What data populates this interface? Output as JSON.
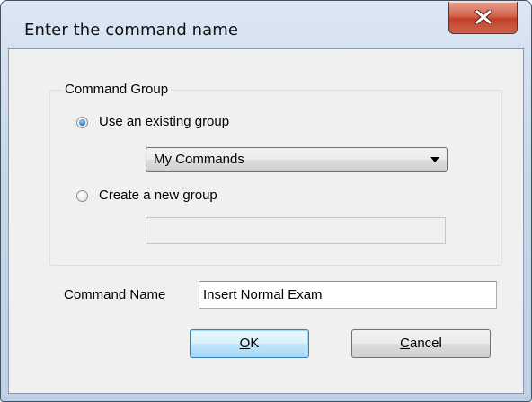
{
  "window": {
    "title": "Enter the command name",
    "close_icon": "close-icon"
  },
  "group": {
    "legend": "Command Group",
    "options": [
      {
        "label": "Use an existing group",
        "checked": true
      },
      {
        "label": "Create a new group",
        "checked": false
      }
    ],
    "existing_group_selected": "My Commands",
    "new_group_value": ""
  },
  "command": {
    "label": "Command Name",
    "value": "Insert Normal Exam"
  },
  "buttons": {
    "ok_mnemonic": "O",
    "ok_rest": "K",
    "cancel_mnemonic": "C",
    "cancel_rest": "ancel"
  },
  "colors": {
    "title_bar": "#c7d7e9",
    "close_button": "#c1412a",
    "client_background": "#f0f0f0",
    "radio_selected": "#2a7cc7"
  }
}
